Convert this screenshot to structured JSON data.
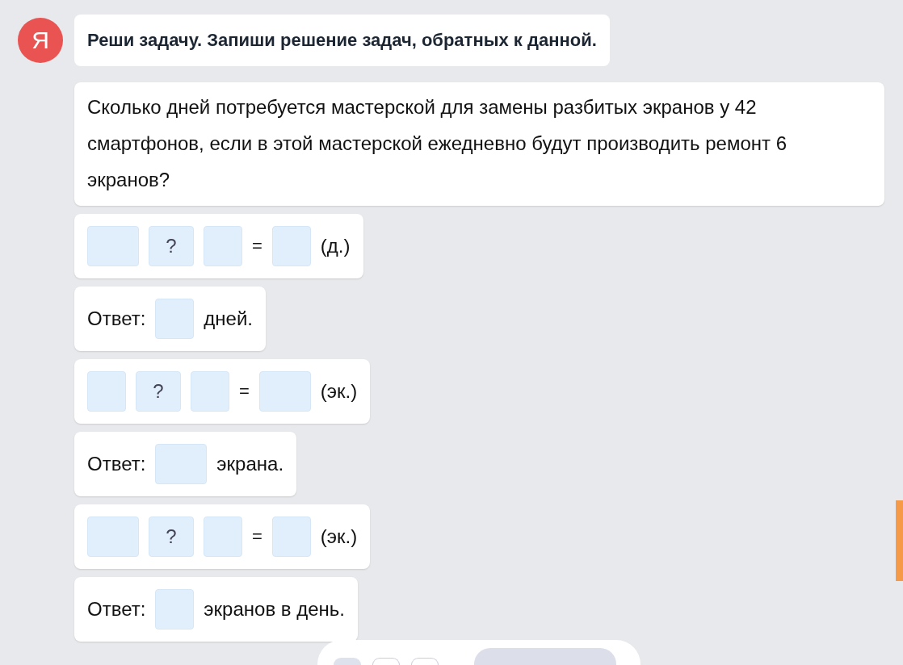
{
  "header": {
    "avatar_letter": "Я",
    "title": "Реши задачу. Запиши решение задач, обратных к данной."
  },
  "problem": {
    "text": "Сколько дней потребуется мастерской для замены разбитых экранов у 42 смартфонов, если в этой мастерской ежедневно будут производить ремонт 6 экранов?"
  },
  "steps": [
    {
      "kind": "equation",
      "boxes": [
        {
          "kind": "wide_blank"
        },
        {
          "kind": "operator",
          "text": "?"
        },
        {
          "kind": "blank"
        },
        {
          "kind": "equals",
          "text": "="
        },
        {
          "kind": "blank"
        }
      ],
      "unit": "(д.)"
    },
    {
      "kind": "answer",
      "label": "Ответ:",
      "boxes": [
        {
          "kind": "blank"
        }
      ],
      "suffix": "дней."
    },
    {
      "kind": "equation",
      "boxes": [
        {
          "kind": "blank"
        },
        {
          "kind": "operator",
          "text": "?"
        },
        {
          "kind": "blank"
        },
        {
          "kind": "equals",
          "text": "="
        },
        {
          "kind": "wide_blank"
        }
      ],
      "unit": "(эк.)"
    },
    {
      "kind": "answer",
      "label": "Ответ:",
      "boxes": [
        {
          "kind": "wide_blank"
        }
      ],
      "suffix": "экрана."
    },
    {
      "kind": "equation",
      "boxes": [
        {
          "kind": "wide_blank"
        },
        {
          "kind": "operator",
          "text": "?"
        },
        {
          "kind": "blank"
        },
        {
          "kind": "equals",
          "text": "="
        },
        {
          "kind": "blank"
        }
      ],
      "unit": "(эк.)"
    },
    {
      "kind": "answer",
      "label": "Ответ:",
      "boxes": [
        {
          "kind": "blank"
        }
      ],
      "suffix": "экранов в день."
    }
  ]
}
